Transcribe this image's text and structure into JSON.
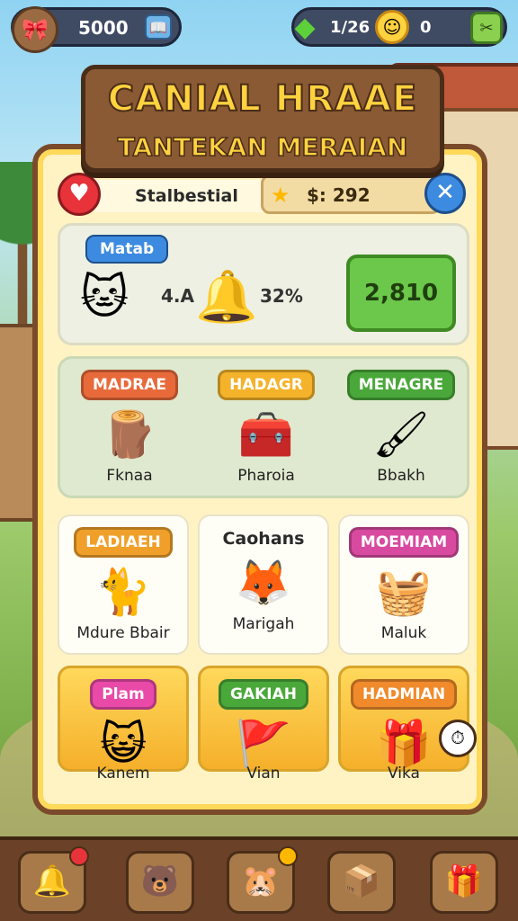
{
  "hud": {
    "coins": "5000",
    "gems": "1/26",
    "zero": "0",
    "avatar_icon": "ribbon-icon",
    "book_icon": "book-icon",
    "gem_icon": "gem-icon",
    "face_icon": "smiley-coin-icon",
    "tool_icon": "tools-icon"
  },
  "title": {
    "main": "CANIAL HRAAE",
    "sub": "TANTEKAN MERAIAN"
  },
  "panel": {
    "header": "Stalbestial",
    "balance": "$: 292",
    "close_symbol": "✕"
  },
  "section1": {
    "label": "Matab",
    "value1": "4.A",
    "value2": "32%",
    "button": "2,810"
  },
  "section2": {
    "tiles": [
      {
        "badge": "MADRAE",
        "name": "Fknaa",
        "color": "#e86a3a"
      },
      {
        "badge": "HADAGR",
        "name": "Pharoia",
        "color": "#f4b32a"
      },
      {
        "badge": "MENAGRE",
        "name": "Bbakh",
        "color": "#4aa83a"
      }
    ]
  },
  "section3": {
    "tiles": [
      {
        "badge": "LADIAEH",
        "name": "Mdure Bbair",
        "color": "#f0a02a"
      },
      {
        "title": "Caohans",
        "name": "Marigah"
      },
      {
        "badge": "MOEMIAM",
        "name": "Maluk",
        "color": "#d84aa0"
      }
    ]
  },
  "section4": {
    "tiles": [
      {
        "badge": "Plam",
        "name": "Kanem",
        "color": "#e94aa8"
      },
      {
        "badge": "GAKIAH",
        "name": "Vian",
        "color": "#4aa83a"
      },
      {
        "badge": "HADMIAN",
        "name": "Vika",
        "color": "#f08a2a"
      }
    ]
  },
  "bottom_nav": [
    {
      "icon": "bell-icon"
    },
    {
      "icon": "pet-icon"
    },
    {
      "icon": "character-icon"
    },
    {
      "icon": "box-icon"
    },
    {
      "icon": "gift-box-icon"
    }
  ]
}
